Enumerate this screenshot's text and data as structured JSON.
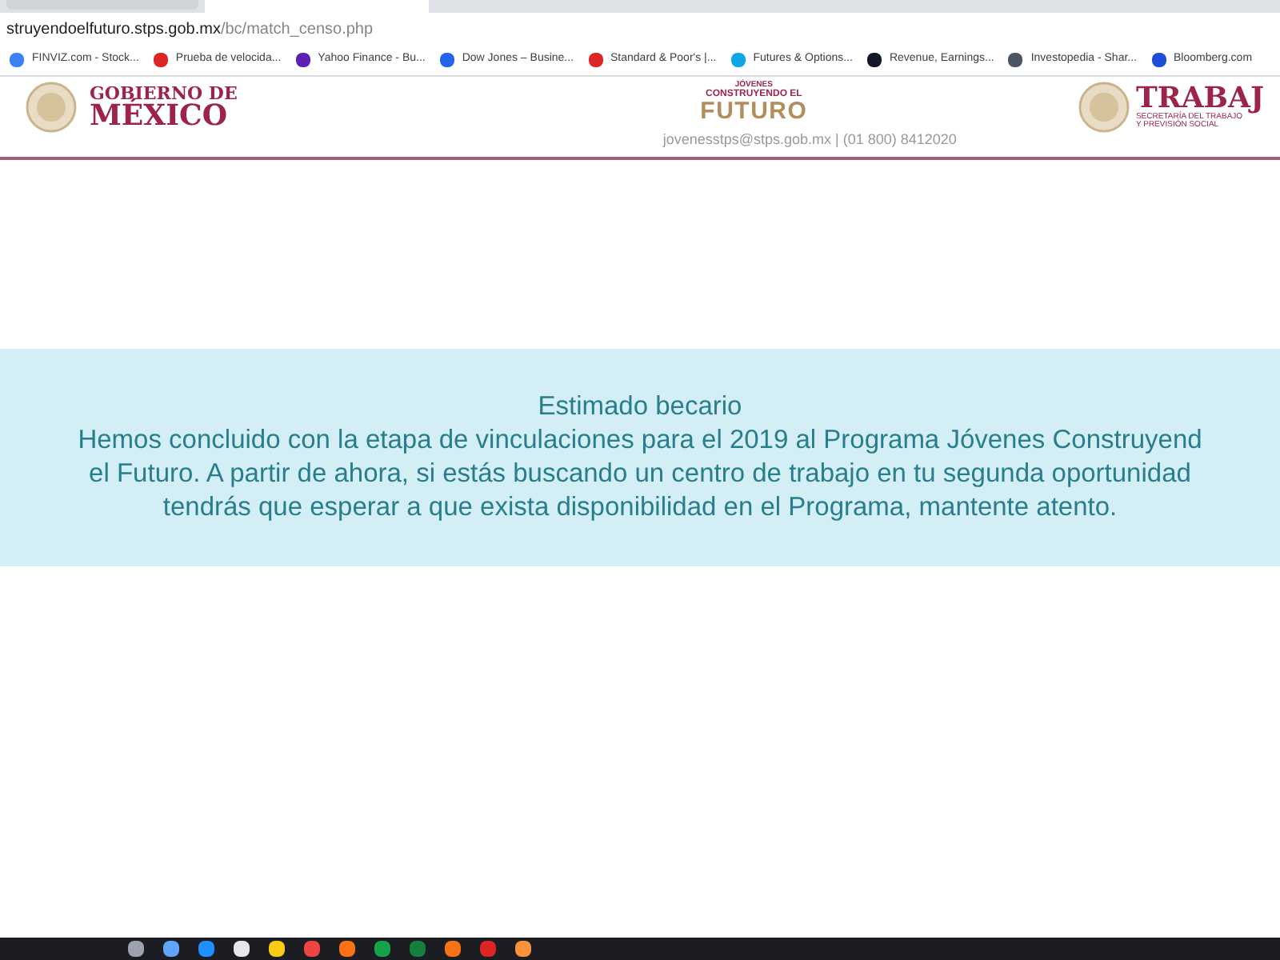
{
  "browser": {
    "address_host": "struyendoelfuturo.stps.gob.mx",
    "address_path": "/bc/match_censo.php",
    "bookmarks": [
      {
        "label": "FINVIZ.com - Stock..."
      },
      {
        "label": "Prueba de velocida..."
      },
      {
        "label": "Yahoo Finance - Bu..."
      },
      {
        "label": "Dow Jones – Busine..."
      },
      {
        "label": "Standard & Poor's |..."
      },
      {
        "label": "Futures & Options..."
      },
      {
        "label": "Revenue, Earnings..."
      },
      {
        "label": "Investopedia - Shar..."
      },
      {
        "label": "Bloomberg.com"
      }
    ]
  },
  "header": {
    "gob_line1": "GOBIERNO DE",
    "gob_line2": "MÉXICO",
    "jovenes_line1": "JÓVENES",
    "jovenes_line2": "CONSTRUYENDO EL",
    "futuro": "FUTURO",
    "contact": "jovenesstps@stps.gob.mx | (01 800) 8412020",
    "trabajo": "TRABAJ",
    "secretaria_line1": "SECRETARÍA DEL TRABAJO",
    "secretaria_line2": "Y PREVISIÓN SOCIAL"
  },
  "notice": {
    "title": "Estimado becario",
    "lines": [
      "Hemos concluido con la etapa de vinculaciones para el 2019 al Programa Jóvenes Construyend",
      "el Futuro. A partir de ahora, si estás buscando un centro de trabajo en tu segunda oportunidad",
      "tendrás que esperar a que exista disponibilidad en el Programa, mantente atento."
    ]
  }
}
